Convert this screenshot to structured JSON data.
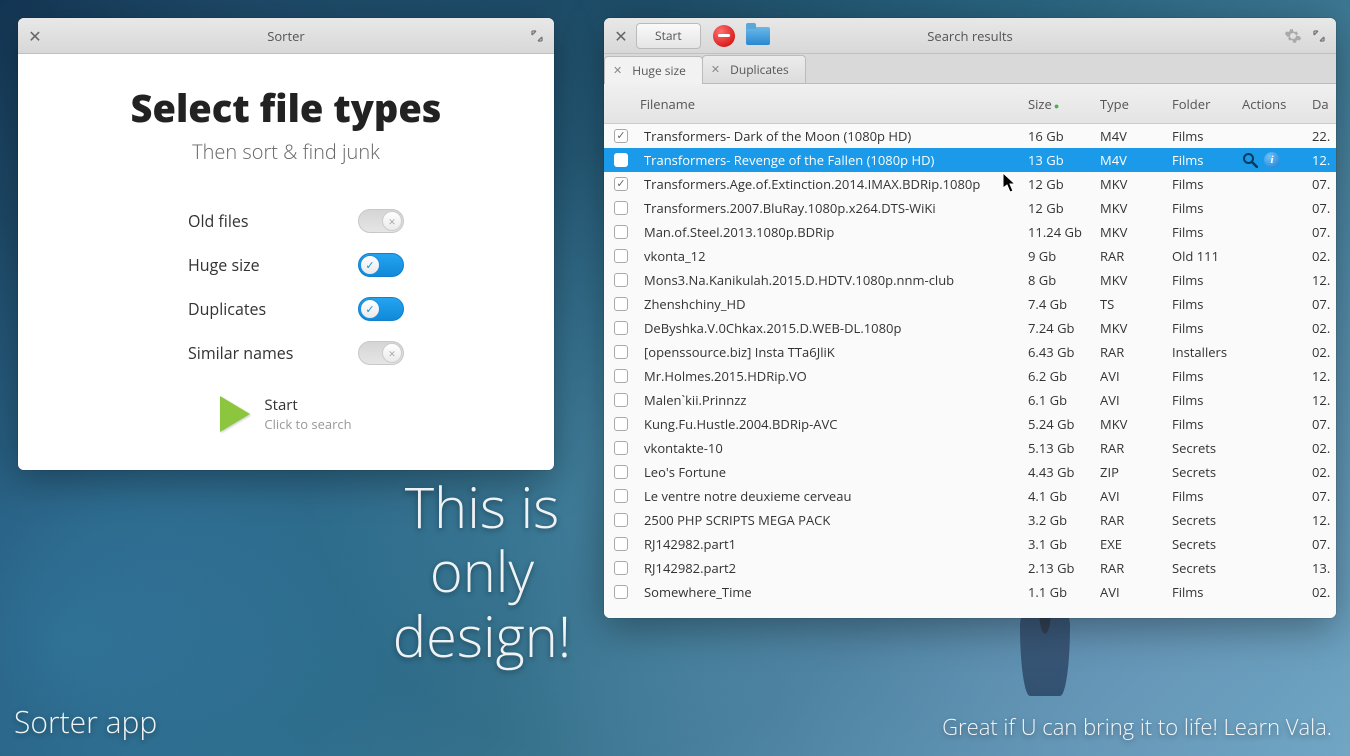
{
  "sorter": {
    "title": "Sorter",
    "heading": "Select file types",
    "subheading": "Then sort & find junk",
    "options": [
      {
        "label": "Old files",
        "on": false
      },
      {
        "label": "Huge size",
        "on": true
      },
      {
        "label": "Duplicates",
        "on": true
      },
      {
        "label": "Similar names",
        "on": false
      }
    ],
    "start_label": "Start",
    "start_hint": "Click to search"
  },
  "results": {
    "title": "Search results",
    "toolbar_start": "Start",
    "tabs": [
      {
        "label": "Huge size",
        "active": true
      },
      {
        "label": "Duplicates",
        "active": false
      }
    ],
    "columns": {
      "name": "Filename",
      "size": "Size",
      "type": "Type",
      "folder": "Folder",
      "actions": "Actions",
      "date": "Da"
    },
    "sorted_by": "size",
    "rows": [
      {
        "checked": true,
        "selected": false,
        "name": "Transformers- Dark of the Moon (1080p HD)",
        "size": "16 Gb",
        "type": "M4V",
        "folder": "Films",
        "date": "22."
      },
      {
        "checked": false,
        "selected": true,
        "name": "Transformers- Revenge of the Fallen (1080p HD)",
        "size": "13 Gb",
        "type": "M4V",
        "folder": "Films",
        "date": "12."
      },
      {
        "checked": true,
        "selected": false,
        "name": "Transformers.Age.of.Extinction.2014.IMAX.BDRip.1080p",
        "size": "12 Gb",
        "type": "MKV",
        "folder": "Films",
        "date": "07."
      },
      {
        "checked": false,
        "selected": false,
        "name": "Transformers.2007.BluRay.1080p.x264.DTS-WiKi",
        "size": "12 Gb",
        "type": "MKV",
        "folder": "Films",
        "date": "07."
      },
      {
        "checked": false,
        "selected": false,
        "name": "Man.of.Steel.2013.1080p.BDRip",
        "size": "11.24 Gb",
        "type": "MKV",
        "folder": "Films",
        "date": "07."
      },
      {
        "checked": false,
        "selected": false,
        "name": "vkonta_12",
        "size": "9 Gb",
        "type": "RAR",
        "folder": "Old 111",
        "date": "02."
      },
      {
        "checked": false,
        "selected": false,
        "name": "Mons3.Na.Kanikulah.2015.D.HDTV.1080p.nnm-club",
        "size": "8 Gb",
        "type": "MKV",
        "folder": "Films",
        "date": "12."
      },
      {
        "checked": false,
        "selected": false,
        "name": "Zhenshchiny_HD",
        "size": "7.4 Gb",
        "type": "TS",
        "folder": "Films",
        "date": "07."
      },
      {
        "checked": false,
        "selected": false,
        "name": "DeByshka.V.0Chkax.2015.D.WEB-DL.1080p",
        "size": "7.24 Gb",
        "type": "MKV",
        "folder": "Films",
        "date": "02."
      },
      {
        "checked": false,
        "selected": false,
        "name": "[openssource.biz] Insta TTa6JliK",
        "size": "6.43 Gb",
        "type": "RAR",
        "folder": "Installers",
        "date": "02."
      },
      {
        "checked": false,
        "selected": false,
        "name": "Mr.Holmes.2015.HDRip.VO",
        "size": "6.2 Gb",
        "type": "AVI",
        "folder": "Films",
        "date": "12."
      },
      {
        "checked": false,
        "selected": false,
        "name": "Malen`kii.Prinnzz",
        "size": "6.1 Gb",
        "type": "AVI",
        "folder": "Films",
        "date": "12."
      },
      {
        "checked": false,
        "selected": false,
        "name": "Kung.Fu.Hustle.2004.BDRip-AVC",
        "size": "5.24 Gb",
        "type": "MKV",
        "folder": "Films",
        "date": "07."
      },
      {
        "checked": false,
        "selected": false,
        "name": "vkontakte-10",
        "size": "5.13 Gb",
        "type": "RAR",
        "folder": "Secrets",
        "date": "02."
      },
      {
        "checked": false,
        "selected": false,
        "name": "Leo's Fortune",
        "size": "4.43 Gb",
        "type": "ZIP",
        "folder": "Secrets",
        "date": "02."
      },
      {
        "checked": false,
        "selected": false,
        "name": "Le ventre notre deuxieme cerveau",
        "size": "4.1 Gb",
        "type": "AVI",
        "folder": "Films",
        "date": "07."
      },
      {
        "checked": false,
        "selected": false,
        "name": "2500 PHP SCRIPTS MEGA PACK",
        "size": "3.2 Gb",
        "type": "RAR",
        "folder": "Secrets",
        "date": "12."
      },
      {
        "checked": false,
        "selected": false,
        "name": "RJ142982.part1",
        "size": "3.1 Gb",
        "type": "EXE",
        "folder": "Secrets",
        "date": "07."
      },
      {
        "checked": false,
        "selected": false,
        "name": "RJ142982.part2",
        "size": "2.13 Gb",
        "type": "RAR",
        "folder": "Secrets",
        "date": "13."
      },
      {
        "checked": false,
        "selected": false,
        "name": "Somewhere_Time",
        "size": "1.1 Gb",
        "type": "AVI",
        "folder": "Films",
        "date": "02."
      }
    ]
  },
  "desktop": {
    "big": "This is only design!",
    "bottom_left": "Sorter app",
    "bottom_right": "Great if U can bring it to life!  Learn Vala."
  }
}
